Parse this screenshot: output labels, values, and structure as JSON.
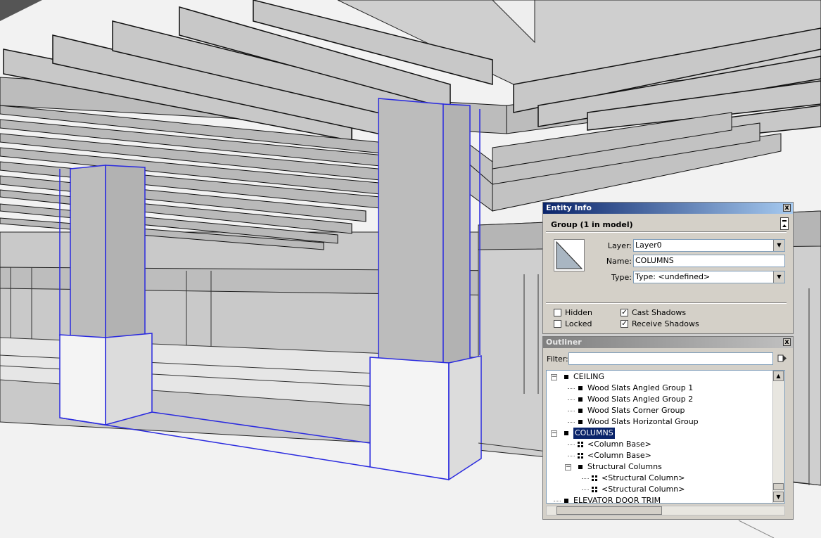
{
  "entity_info": {
    "title": "Entity Info",
    "close_label": "x",
    "header": "Group (1 in model)",
    "layer_label": "Layer:",
    "layer_value": "Layer0",
    "name_label": "Name:",
    "name_value": "COLUMNS",
    "type_label": "Type:",
    "type_value": "Type: <undefined>",
    "hidden_label": "Hidden",
    "hidden_checked": false,
    "locked_label": "Locked",
    "locked_checked": false,
    "cast_shadows_label": "Cast Shadows",
    "cast_shadows_checked": true,
    "receive_shadows_label": "Receive Shadows",
    "receive_shadows_checked": true
  },
  "outliner": {
    "title": "Outliner",
    "close_label": "x",
    "filter_label": "Filter:",
    "filter_value": "",
    "tree": [
      {
        "label": "CEILING",
        "level": 0,
        "expander": "−",
        "icon": "group"
      },
      {
        "label": "Wood Slats Angled Group 1",
        "level": 1,
        "expander": "",
        "icon": "group"
      },
      {
        "label": "Wood Slats Angled Group 2",
        "level": 1,
        "expander": "",
        "icon": "group"
      },
      {
        "label": "Wood Slats Corner Group",
        "level": 1,
        "expander": "",
        "icon": "group"
      },
      {
        "label": "Wood Slats Horizontal Group",
        "level": 1,
        "expander": "",
        "icon": "group"
      },
      {
        "label": "COLUMNS",
        "level": 0,
        "expander": "−",
        "icon": "group",
        "selected": true
      },
      {
        "label": "<Column Base>",
        "level": 1,
        "expander": "",
        "icon": "component"
      },
      {
        "label": "<Column Base>",
        "level": 1,
        "expander": "",
        "icon": "component"
      },
      {
        "label": "Structural Columns",
        "level": 1,
        "expander": "−",
        "icon": "group"
      },
      {
        "label": "<Structural Column>",
        "level": 2,
        "expander": "",
        "icon": "component"
      },
      {
        "label": "<Structural Column>",
        "level": 2,
        "expander": "",
        "icon": "component"
      },
      {
        "label": "ELEVATOR DOOR TRIM",
        "level": 0,
        "expander": "",
        "icon": "group"
      }
    ]
  },
  "colors": {
    "selection_edge": "#2a2adf",
    "panel_bg": "#d4d0c8",
    "title_active": "#0a246a"
  }
}
